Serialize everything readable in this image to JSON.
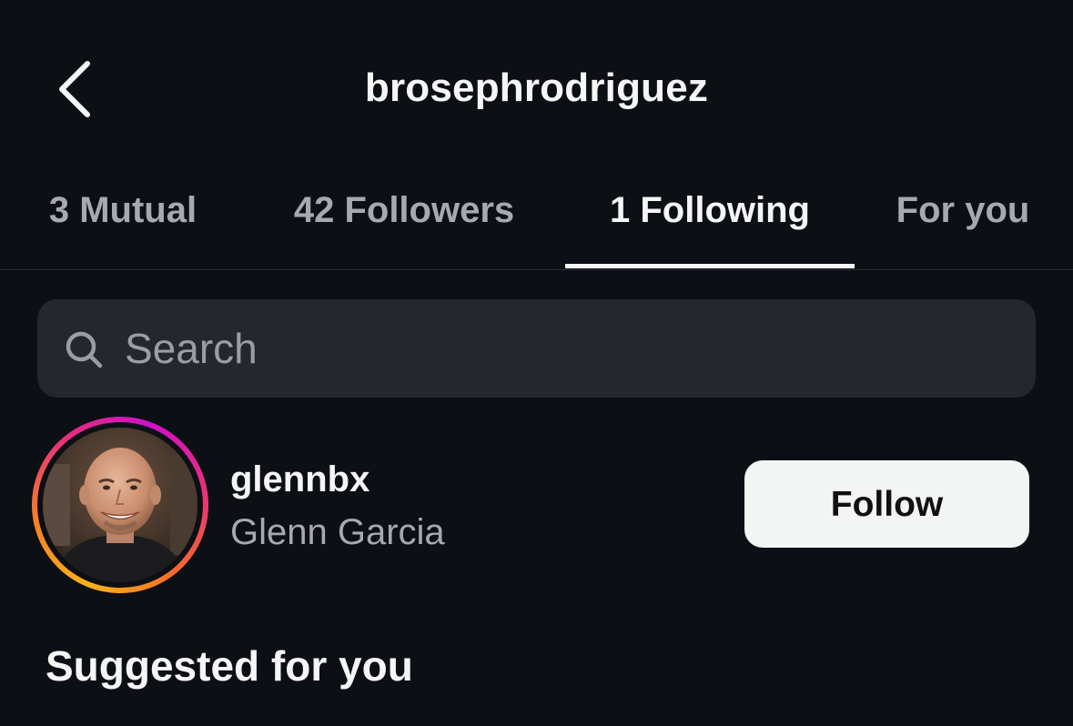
{
  "header": {
    "title": "brosephrodriguez",
    "back_icon": "chevron-left-icon"
  },
  "tabs": [
    {
      "label": "3 Mutual",
      "active": false
    },
    {
      "label": "42 Followers",
      "active": false
    },
    {
      "label": "1 Following",
      "active": true
    },
    {
      "label": "For you",
      "active": false
    }
  ],
  "search": {
    "placeholder": "Search",
    "value": "",
    "icon": "search-icon"
  },
  "following": [
    {
      "username": "glennbx",
      "full_name": "Glenn Garcia",
      "button_label": "Follow",
      "has_story_ring": true
    }
  ],
  "suggested": {
    "title": "Suggested for you"
  },
  "colors": {
    "background": "#0c0f14",
    "search_bg": "#24272c",
    "text_primary": "#f5f5f5",
    "text_secondary": "#a6a9ae",
    "button_bg": "#f3f4f4",
    "story_ring": [
      "#f9b21b",
      "#f77e27",
      "#e72f7c",
      "#d010c8"
    ]
  }
}
